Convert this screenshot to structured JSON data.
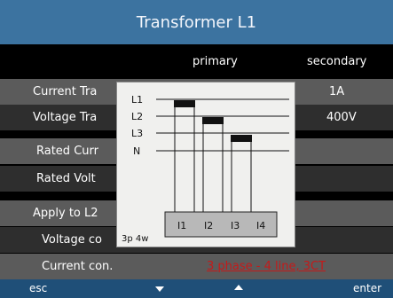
{
  "window": {
    "title": "Transformer L1"
  },
  "columns": {
    "primary": "primary",
    "secondary": "secondary"
  },
  "rows": [
    {
      "label": "Current Tra",
      "secondary": "1A"
    },
    {
      "label": "Voltage Tra",
      "secondary": "400V"
    },
    {
      "label": "Rated Curr",
      "secondary": ""
    },
    {
      "label": "Rated Volt",
      "secondary": ""
    },
    {
      "label": "Apply to L2",
      "secondary": ""
    },
    {
      "label": "Voltage co",
      "secondary": ""
    },
    {
      "label": "Current con.",
      "value": "3 phase - 4 line, 3CT"
    }
  ],
  "diagram": {
    "lines": [
      "L1",
      "L2",
      "L3",
      "N"
    ],
    "mode": "3p 4w",
    "terminals": [
      "I1",
      "I2",
      "I3",
      "I4"
    ]
  },
  "footer": {
    "esc": "esc",
    "enter": "enter"
  },
  "colors": {
    "title_bar": "#3c73a0",
    "footer": "#1f4f78",
    "link": "#c41a1a"
  }
}
